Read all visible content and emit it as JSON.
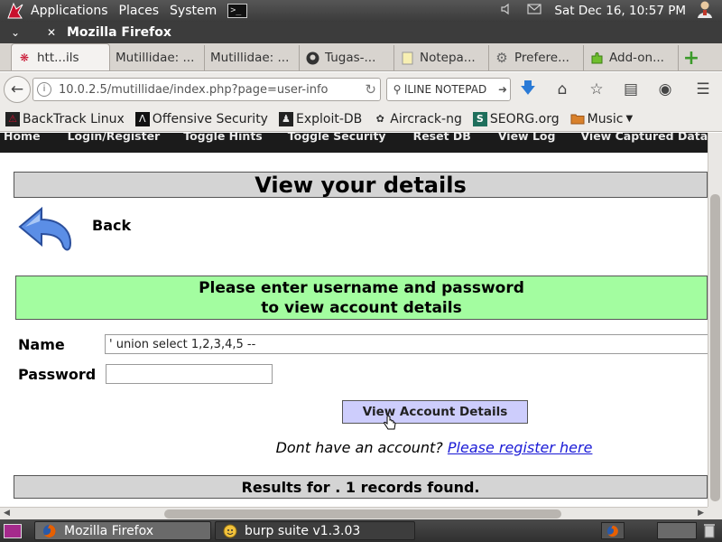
{
  "panel": {
    "menus": [
      "Applications",
      "Places",
      "System"
    ],
    "clock": "Sat Dec 16, 10:57 PM"
  },
  "window": {
    "title": "Mozilla Firefox"
  },
  "tabs": [
    {
      "label": "htt...ils",
      "icon": "bug-favicon",
      "active": true
    },
    {
      "label": "Mutillidae: ...",
      "icon": "none",
      "active": false
    },
    {
      "label": "Mutillidae: ...",
      "icon": "none",
      "active": false
    },
    {
      "label": "Tugas-...",
      "icon": "github-icon",
      "active": false
    },
    {
      "label": "Notepa...",
      "icon": "notepad-icon",
      "active": false
    },
    {
      "label": "Prefere...",
      "icon": "gear-icon",
      "active": false
    },
    {
      "label": "Add-on...",
      "icon": "puzzle-icon",
      "active": false
    }
  ],
  "navbar": {
    "url": "10.0.2.5/mutillidae/index.php?page=user-info",
    "search_text": "lLINE NOTEPAD"
  },
  "bookmarks": [
    {
      "label": "BackTrack Linux",
      "icon": "backtrack-icon"
    },
    {
      "label": "Offensive Security",
      "icon": "offsec-icon"
    },
    {
      "label": "Exploit-DB",
      "icon": "exploitdb-icon"
    },
    {
      "label": "Aircrack-ng",
      "icon": "aircrack-icon"
    },
    {
      "label": "SEORG.org",
      "icon": "seorg-icon"
    },
    {
      "label": "Music",
      "icon": "folder-icon"
    }
  ],
  "site_nav": [
    "Home",
    "Login/Register",
    "Toggle Hints",
    "Toggle Security",
    "Reset DB",
    "View Log",
    "View Captured Data"
  ],
  "page": {
    "heading": "View your details",
    "back_label": "Back",
    "prompt_line1": "Please enter username and password",
    "prompt_line2": "to view account details",
    "name_label": "Name",
    "name_value": "' union select 1,2,3,4,5 --",
    "password_label": "Password",
    "password_value": "",
    "submit_label": "View Account Details",
    "register_prefix": "Dont have an account?",
    "register_link": "Please register here",
    "results": "Results for . 1 records found."
  },
  "taskbar": [
    {
      "label": "Mozilla Firefox",
      "icon": "firefox-icon",
      "active": true
    },
    {
      "label": "burp suite v1.3.03",
      "icon": "burp-icon",
      "active": false
    }
  ],
  "colors": {
    "prompt_bg": "#a3fda0",
    "heading_bg": "#d4d4d4",
    "button_bg": "#cdcdfc",
    "link": "#1a1ad6",
    "site_nav_bg": "#1b1b1b"
  }
}
